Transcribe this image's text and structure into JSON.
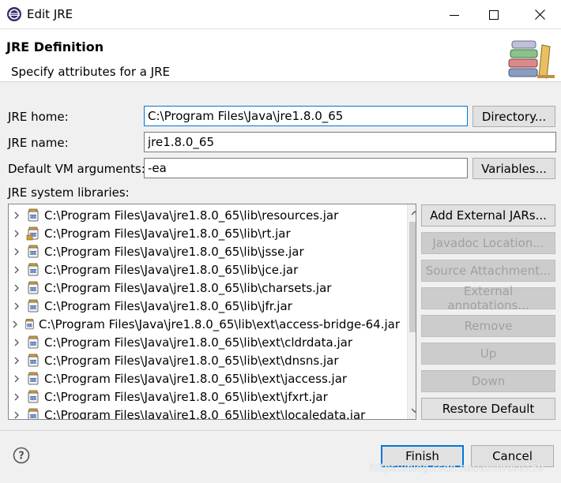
{
  "window": {
    "title": "Edit JRE"
  },
  "header": {
    "title": "JRE Definition",
    "description": "Specify attributes for a JRE"
  },
  "form": {
    "jre_home_label": "JRE home:",
    "jre_home_value": "C:\\Program Files\\Java\\jre1.8.0_65",
    "directory_button": "Directory...",
    "jre_name_label": "JRE name:",
    "jre_name_value": "jre1.8.0_65",
    "vm_args_label": "Default VM arguments:",
    "vm_args_value": "-ea",
    "variables_button": "Variables...",
    "libraries_label": "JRE system libraries:"
  },
  "libraries": [
    "C:\\Program Files\\Java\\jre1.8.0_65\\lib\\resources.jar",
    "C:\\Program Files\\Java\\jre1.8.0_65\\lib\\rt.jar",
    "C:\\Program Files\\Java\\jre1.8.0_65\\lib\\jsse.jar",
    "C:\\Program Files\\Java\\jre1.8.0_65\\lib\\jce.jar",
    "C:\\Program Files\\Java\\jre1.8.0_65\\lib\\charsets.jar",
    "C:\\Program Files\\Java\\jre1.8.0_65\\lib\\jfr.jar",
    "C:\\Program Files\\Java\\jre1.8.0_65\\lib\\ext\\access-bridge-64.jar",
    "C:\\Program Files\\Java\\jre1.8.0_65\\lib\\ext\\cldrdata.jar",
    "C:\\Program Files\\Java\\jre1.8.0_65\\lib\\ext\\dnsns.jar",
    "C:\\Program Files\\Java\\jre1.8.0_65\\lib\\ext\\jaccess.jar",
    "C:\\Program Files\\Java\\jre1.8.0_65\\lib\\ext\\jfxrt.jar",
    "C:\\Program Files\\Java\\jre1.8.0_65\\lib\\ext\\localedata.jar"
  ],
  "side_buttons": {
    "add_external_jars": "Add External JARs...",
    "javadoc_location": "Javadoc Location...",
    "source_attachment": "Source Attachment...",
    "external_annotations": "External annotations...",
    "remove": "Remove",
    "up": "Up",
    "down": "Down",
    "restore_default": "Restore Default"
  },
  "footer": {
    "finish": "Finish",
    "cancel": "Cancel",
    "watermark": "https://blog.csdn.net/ambrose159"
  },
  "colors": {
    "accent": "#0078d7",
    "disabled_text": "#a0a0a0"
  }
}
